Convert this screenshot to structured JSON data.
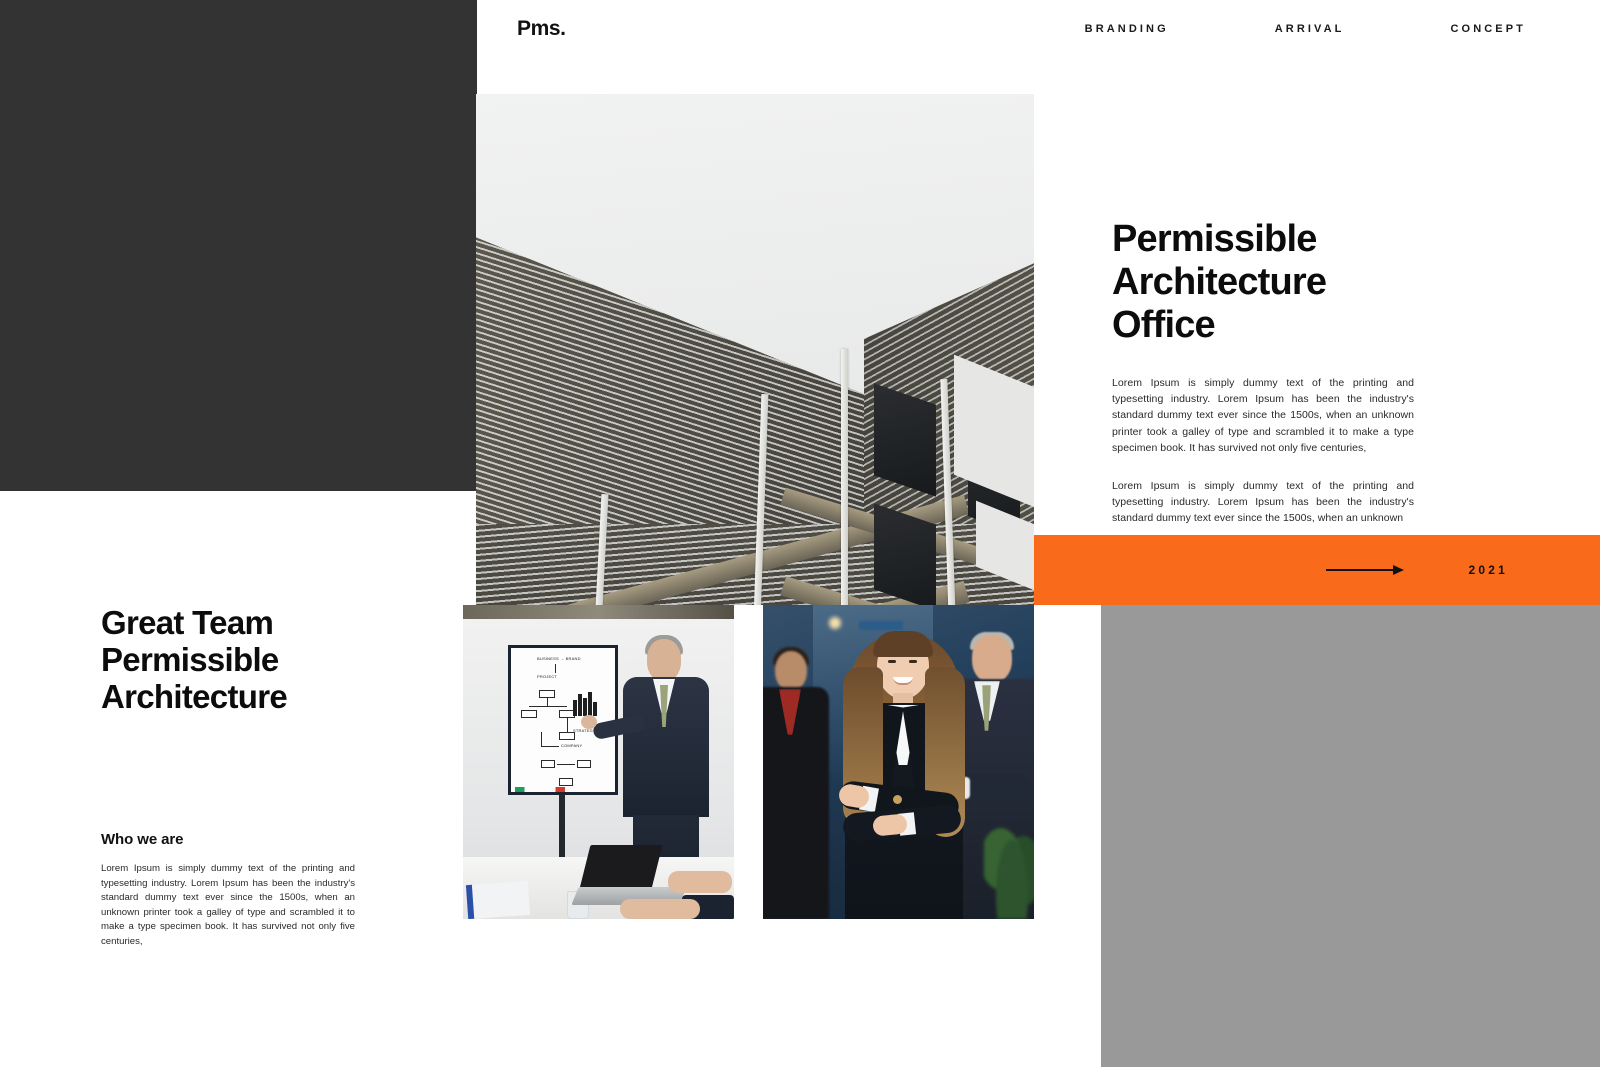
{
  "header": {
    "logo": "Pms.",
    "nav": [
      {
        "label": "BRANDING"
      },
      {
        "label": "ARRIVAL"
      },
      {
        "label": "CONCEPT"
      }
    ]
  },
  "hero": {
    "image_alt": "modern building corner seen from below against pale sky"
  },
  "right_column": {
    "title": "Permissible Architecture Office",
    "paragraph_1": "Lorem Ipsum is simply dummy text of the printing and typesetting industry. Lorem Ipsum has been the industry's standard dummy text ever since the 1500s, when an unknown printer took a galley of type and scrambled it to make a type specimen book. It has survived not only five centuries,",
    "paragraph_2": "Lorem Ipsum is simply dummy text of the printing and typesetting industry. Lorem Ipsum has been the industry's standard dummy text ever since the 1500s, when an unknown"
  },
  "banner": {
    "year": "2021",
    "arrow_icon": "arrow-right-icon",
    "background_color": "#f96a1b"
  },
  "left_column": {
    "title": "Great Team Permissible Architecture",
    "subheading": "Who we are",
    "paragraph": "Lorem Ipsum is simply dummy text of the printing and typesetting industry. Lorem Ipsum has been the industry's standard dummy text ever since the 1500s, when an unknown printer took a galley of type and scrambled it to make a type specimen book. It has survived not only five centuries,"
  },
  "photos": {
    "presentation_alt": "businessman presenting a strategy diagram on a flipchart",
    "team_alt": "smiling businesswoman with arms crossed in front of two colleagues"
  },
  "decor": {
    "dark_block_color": "#333333",
    "gray_block_color": "#999999"
  }
}
